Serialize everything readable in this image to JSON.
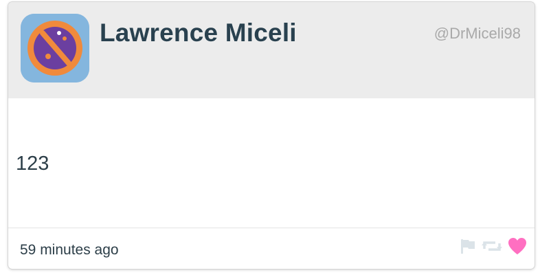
{
  "user": {
    "name": "Lawrence Miceli",
    "handle": "@DrMiceli98"
  },
  "post": {
    "text": "123",
    "timestamp": "59 minutes ago"
  },
  "icons": {
    "avatar": "planet-avatar-icon",
    "flag": "flag-icon",
    "retweet": "retweet-icon",
    "like": "heart-icon"
  },
  "colors": {
    "header_bg": "#ececec",
    "name": "#29414f",
    "handle": "#a9a9a9",
    "avatar_bg": "#84b6de",
    "avatar_ring": "#f08a3c",
    "avatar_planet": "#6b3fa0",
    "action_inactive": "#dbe3e8",
    "heart": "#ff6fc1"
  }
}
